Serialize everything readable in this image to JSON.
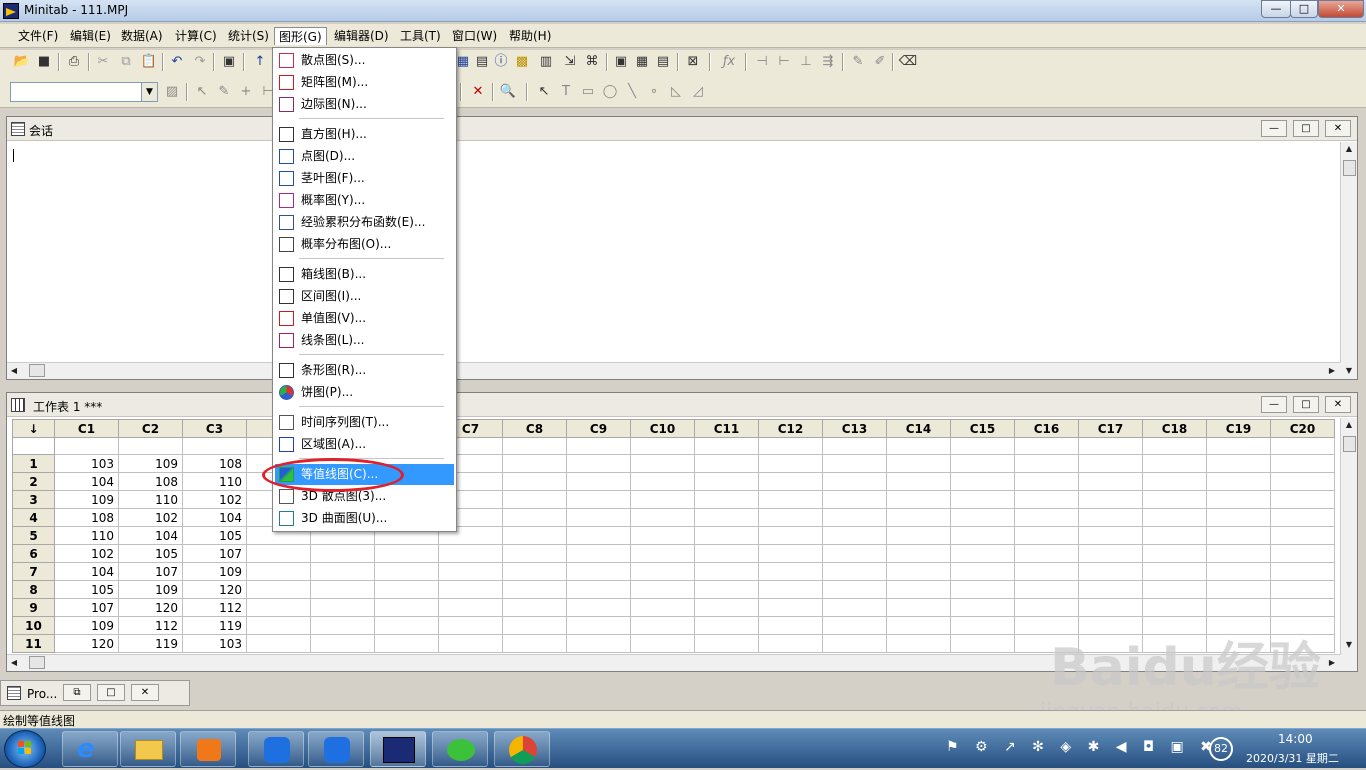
{
  "window": {
    "title": "Minitab - 111.MPJ",
    "min_label": "—",
    "max_label": "□",
    "close_label": "✕"
  },
  "menu": [
    "文件(F)",
    "编辑(E)",
    "数据(A)",
    "计算(C)",
    "统计(S)",
    "图形(G)",
    "编辑器(D)",
    "工具(T)",
    "窗口(W)",
    "帮助(H)"
  ],
  "session": {
    "title": "会话",
    "min_label": "—",
    "max_label": "□",
    "close_label": "✕"
  },
  "worksheet": {
    "title": "工作表 1 ***",
    "min_label": "—",
    "max_label": "□",
    "close_label": "✕",
    "corner_label": "↓",
    "columns": [
      "C1",
      "C2",
      "C3",
      "",
      "",
      "",
      "C7",
      "C8",
      "C9",
      "C10",
      "C11",
      "C12",
      "C13",
      "C14",
      "C15",
      "C16",
      "C17",
      "C18",
      "C19",
      "C20"
    ],
    "rows": [
      {
        "n": "1",
        "c1": "103",
        "c2": "109",
        "c3": "108"
      },
      {
        "n": "2",
        "c1": "104",
        "c2": "108",
        "c3": "110"
      },
      {
        "n": "3",
        "c1": "109",
        "c2": "110",
        "c3": "102"
      },
      {
        "n": "4",
        "c1": "108",
        "c2": "102",
        "c3": "104"
      },
      {
        "n": "5",
        "c1": "110",
        "c2": "104",
        "c3": "105"
      },
      {
        "n": "6",
        "c1": "102",
        "c2": "105",
        "c3": "107"
      },
      {
        "n": "7",
        "c1": "104",
        "c2": "107",
        "c3": "109"
      },
      {
        "n": "8",
        "c1": "105",
        "c2": "109",
        "c3": "120"
      },
      {
        "n": "9",
        "c1": "107",
        "c2": "120",
        "c3": "112"
      },
      {
        "n": "10",
        "c1": "109",
        "c2": "112",
        "c3": "119"
      },
      {
        "n": "11",
        "c1": "120",
        "c2": "119",
        "c3": "103"
      }
    ]
  },
  "graph_menu": {
    "items": [
      {
        "label": "散点图(S)...",
        "icon": "scatter-icon"
      },
      {
        "label": "矩阵图(M)...",
        "icon": "matrix-icon"
      },
      {
        "label": "边际图(N)...",
        "icon": "marginal-icon"
      },
      {
        "label": "直方图(H)...",
        "icon": "histogram-icon"
      },
      {
        "label": "点图(D)...",
        "icon": "dotplot-icon"
      },
      {
        "label": "茎叶图(F)...",
        "icon": "stem-leaf-icon"
      },
      {
        "label": "概率图(Y)...",
        "icon": "probability-icon"
      },
      {
        "label": "经验累积分布函数(E)...",
        "icon": "ecdf-icon"
      },
      {
        "label": "概率分布图(O)...",
        "icon": "distribution-icon"
      },
      {
        "label": "箱线图(B)...",
        "icon": "boxplot-icon"
      },
      {
        "label": "区间图(I)...",
        "icon": "interval-icon"
      },
      {
        "label": "单值图(V)...",
        "icon": "individual-value-icon"
      },
      {
        "label": "线条图(L)...",
        "icon": "line-plot-icon"
      },
      {
        "label": "条形图(R)...",
        "icon": "bar-chart-icon"
      },
      {
        "label": "饼图(P)...",
        "icon": "pie-chart-icon"
      },
      {
        "label": "时间序列图(T)...",
        "icon": "time-series-icon"
      },
      {
        "label": "区域图(A)...",
        "icon": "area-graph-icon"
      },
      {
        "label": "等值线图(C)...",
        "icon": "contour-icon"
      },
      {
        "label": "3D 散点图(3)...",
        "icon": "scatter-3d-icon"
      },
      {
        "label": "3D 曲面图(U)...",
        "icon": "surface-3d-icon"
      }
    ],
    "highlighted": "等值线图(C)..."
  },
  "project_minimized": {
    "label": "Pro..."
  },
  "status_text": "绘制等值线图",
  "taskbar": {
    "time": "14:00",
    "date": "2020/3/31 星期二",
    "badge": "82"
  },
  "watermark": {
    "logo": "Baidu经验",
    "url": "jingyan.baidu.com"
  },
  "colors": {
    "highlight": "#3399ff",
    "annotation": "#e0202a",
    "menubar": "#ece9d8"
  }
}
